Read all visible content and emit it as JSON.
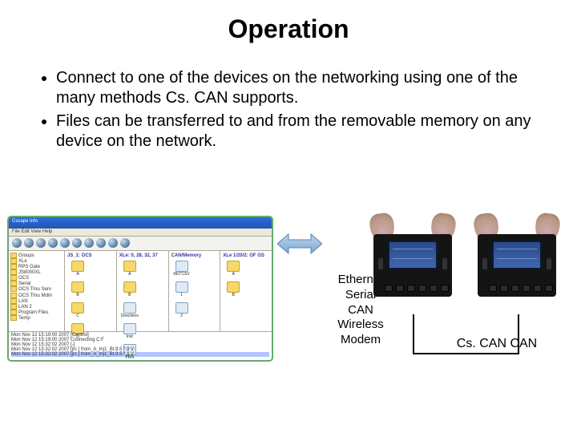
{
  "title": "Operation",
  "bullets": [
    "Connect to one of the devices on the networking using one of the many methods Cs. CAN supports.",
    "Files can be transferred to and from the removable memory on any device on the network."
  ],
  "filebrowser": {
    "window_title": "Cscape Info",
    "menubar": "File  Edit  View  Help",
    "tree": [
      "Groups",
      "XLe",
      "RPS Gate",
      "JS8000XL",
      "OCS",
      "Serial",
      "OCS Thru Serv",
      "OCS Thru Mdm",
      "LAN",
      "LAN 2",
      "Program Files",
      "Temp"
    ],
    "pane1": {
      "header": "JS_1: OCS",
      "items": [
        "A",
        "B",
        "C",
        "D"
      ]
    },
    "pane2": {
      "header": "XLe: 0, 28, 32, 37",
      "items": [
        "A",
        "B",
        "Directivos",
        "Inst",
        "PRN"
      ]
    },
    "pane3": {
      "header": "CAN/Memory",
      "items": [
        "RETCSV",
        "1",
        "2"
      ]
    },
    "pane4": {
      "header": "XLe 1/20/2: OF GS",
      "items": [
        "A",
        "B"
      ]
    },
    "log": [
      "Mon Nov 12 15:19:00 2007  [Control]",
      "Mon Nov 12 15:19:00 2007  Connecting C:F",
      "Mon Nov 12 15:32:02 2007  [-]",
      "Mon Nov 12 15:32:02 2007   [jrc  ]  from_A_tnj1_Bt,9.5 *.9 V",
      "Mon Nov 12 15:32:02 2007   [jrc  ]  from_A_tnj1_Bt,9.5 *.9 V"
    ]
  },
  "connections": [
    "Ethernet",
    "Serial",
    "CAN",
    "Wireless",
    "Modem"
  ],
  "cscan_label": "Cs. CAN CAN"
}
